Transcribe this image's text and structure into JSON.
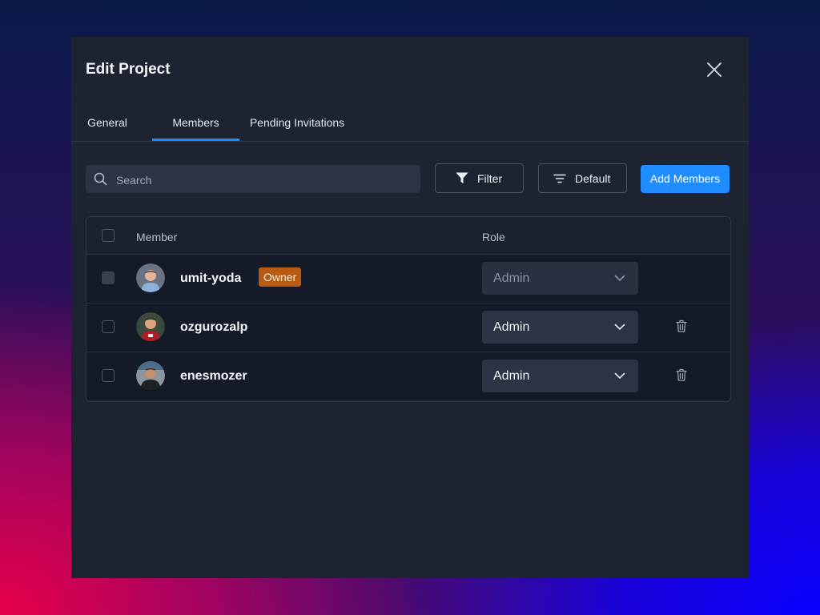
{
  "modal": {
    "title": "Edit Project"
  },
  "tabs": [
    {
      "label": "General",
      "active": false
    },
    {
      "label": "Members",
      "active": true
    },
    {
      "label": "Pending Invitations",
      "active": false
    }
  ],
  "toolbar": {
    "search_placeholder": "Search",
    "filter_label": "Filter",
    "sort_label": "Default",
    "add_label": "Add Members"
  },
  "table": {
    "headers": {
      "member": "Member",
      "role": "Role"
    },
    "rows": [
      {
        "username": "umit-yoda",
        "badge": "Owner",
        "role": "Admin",
        "role_editable": false,
        "deletable": false,
        "avatar": "avatar-photo"
      },
      {
        "username": "ozgurozalp",
        "badge": "",
        "role": "Admin",
        "role_editable": true,
        "deletable": true,
        "avatar": "avatar-photo"
      },
      {
        "username": "enesmozer",
        "badge": "",
        "role": "Admin",
        "role_editable": true,
        "deletable": true,
        "avatar": "avatar-photo"
      }
    ]
  },
  "colors": {
    "accent": "#1f8cff",
    "owner_badge": "#b85a12",
    "modal_bg": "#1e2331",
    "row_bg": "#141a28"
  },
  "icons": {
    "close": "close-icon",
    "search": "search-icon",
    "filter": "filter-icon",
    "sort": "sort-icon",
    "dropdown": "chevron-down-icon",
    "delete": "trash-icon"
  }
}
